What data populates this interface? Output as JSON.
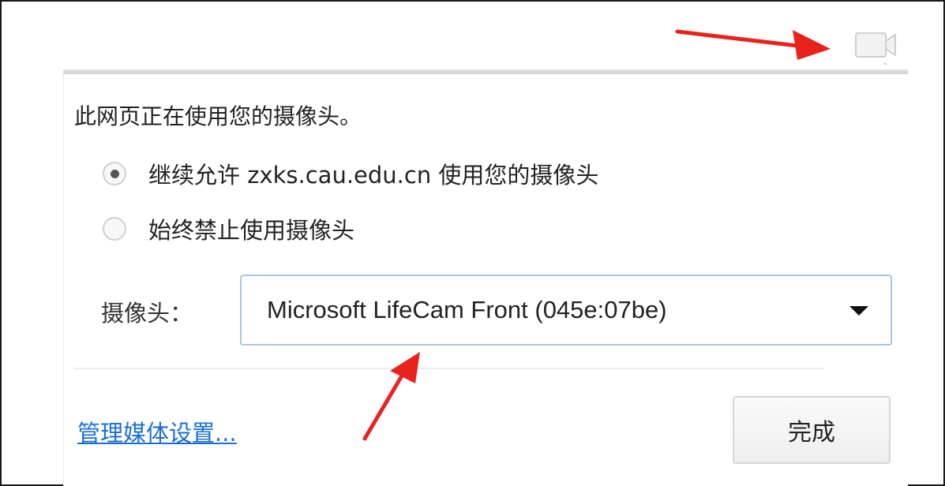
{
  "header": {
    "camera_indicator_icon": "camera-blocked-icon"
  },
  "popup": {
    "title": "此网页正在使用您的摄像头。",
    "options": [
      {
        "label": "继续允许 zxks.cau.edu.cn 使用您的摄像头",
        "selected": true
      },
      {
        "label": "始终禁止使用摄像头",
        "selected": false
      }
    ],
    "camera_label": "摄像头：",
    "camera_select_value": "Microsoft LifeCam Front (045e:07be)",
    "manage_link": "管理媒体设置...",
    "done_button": "完成"
  },
  "annotations": {
    "arrow_color": "#e8231e"
  },
  "colors": {
    "link": "#1a6fd6",
    "select_border": "#a9c4e6"
  }
}
